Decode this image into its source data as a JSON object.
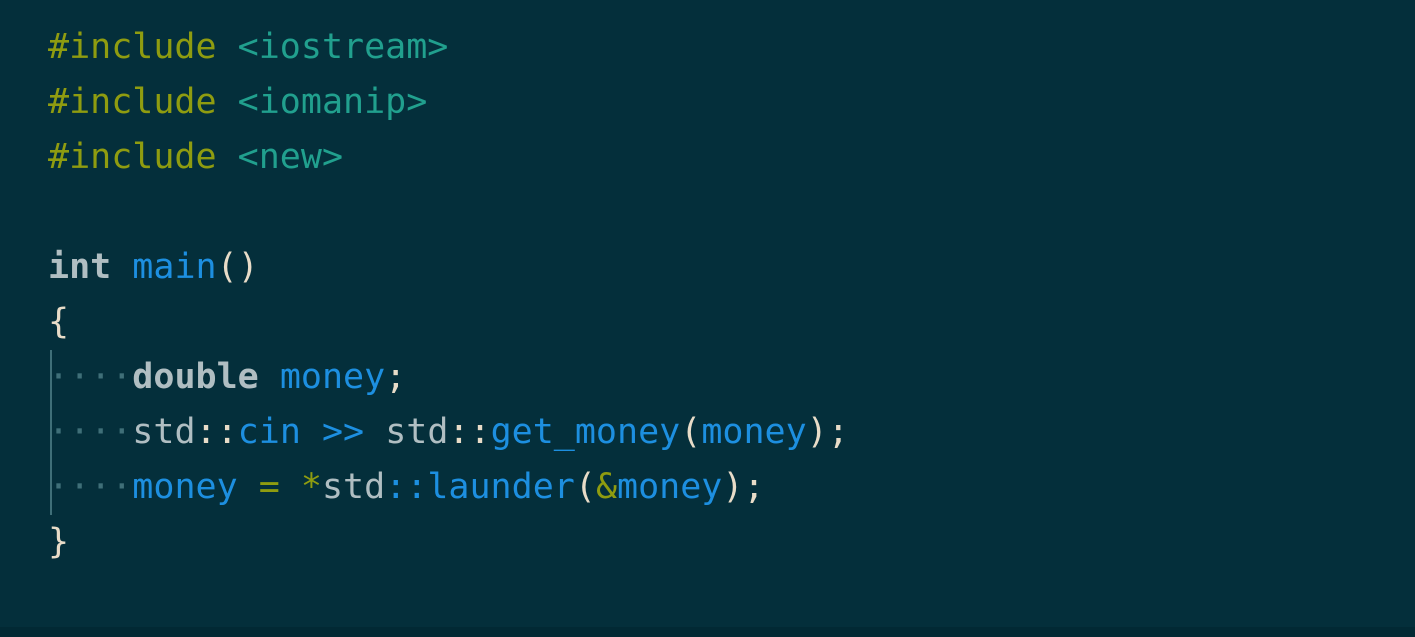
{
  "editor": {
    "language": "cpp",
    "background_color": "#042f3b",
    "whitespace_dot": "·",
    "colors": {
      "background": "#042f3b",
      "preprocessor": "#8f9c10",
      "header_name": "#21a08e",
      "keyword": "#b0bec2",
      "identifier": "#1d8fe0",
      "punctuation": "#e8dcc8",
      "operator": "#8f9c10",
      "namespace": "#b0bec2",
      "indent_guide": "#3f6f78",
      "whitespace_marker": "#3f6f78"
    }
  },
  "code": {
    "lines": [
      {
        "indented": false,
        "tokens": [
          {
            "text": "#include",
            "kind": "preprocessor"
          },
          {
            "text": " ",
            "kind": "plain"
          },
          {
            "text": "<iostream>",
            "kind": "header_name"
          }
        ]
      },
      {
        "indented": false,
        "tokens": [
          {
            "text": "#include",
            "kind": "preprocessor"
          },
          {
            "text": " ",
            "kind": "plain"
          },
          {
            "text": "<iomanip>",
            "kind": "header_name"
          }
        ]
      },
      {
        "indented": false,
        "tokens": [
          {
            "text": "#include",
            "kind": "preprocessor"
          },
          {
            "text": " ",
            "kind": "plain"
          },
          {
            "text": "<new>",
            "kind": "header_name"
          }
        ]
      },
      {
        "indented": false,
        "tokens": []
      },
      {
        "indented": false,
        "tokens": [
          {
            "text": "int",
            "kind": "keyword"
          },
          {
            "text": " ",
            "kind": "plain"
          },
          {
            "text": "main",
            "kind": "identifier"
          },
          {
            "text": "()",
            "kind": "punctuation"
          }
        ]
      },
      {
        "indented": false,
        "tokens": [
          {
            "text": "{",
            "kind": "punctuation"
          }
        ]
      },
      {
        "indented": true,
        "tokens": [
          {
            "text": "····",
            "kind": "whitespace"
          },
          {
            "text": "double",
            "kind": "keyword"
          },
          {
            "text": " ",
            "kind": "plain"
          },
          {
            "text": "money",
            "kind": "identifier"
          },
          {
            "text": ";",
            "kind": "punctuation"
          }
        ]
      },
      {
        "indented": true,
        "tokens": [
          {
            "text": "····",
            "kind": "whitespace"
          },
          {
            "text": "std",
            "kind": "namespace"
          },
          {
            "text": "::",
            "kind": "punctuation"
          },
          {
            "text": "cin",
            "kind": "identifier"
          },
          {
            "text": " ",
            "kind": "plain"
          },
          {
            "text": ">>",
            "kind": "identifier"
          },
          {
            "text": " ",
            "kind": "plain"
          },
          {
            "text": "std",
            "kind": "namespace"
          },
          {
            "text": "::",
            "kind": "punctuation"
          },
          {
            "text": "get_money",
            "kind": "identifier"
          },
          {
            "text": "(",
            "kind": "punctuation"
          },
          {
            "text": "money",
            "kind": "identifier"
          },
          {
            "text": ")",
            "kind": "punctuation"
          },
          {
            "text": ";",
            "kind": "punctuation"
          }
        ]
      },
      {
        "indented": true,
        "tokens": [
          {
            "text": "····",
            "kind": "whitespace"
          },
          {
            "text": "money",
            "kind": "identifier"
          },
          {
            "text": " ",
            "kind": "plain"
          },
          {
            "text": "=",
            "kind": "operator"
          },
          {
            "text": " ",
            "kind": "plain"
          },
          {
            "text": "*",
            "kind": "operator"
          },
          {
            "text": "std",
            "kind": "namespace"
          },
          {
            "text": "::",
            "kind": "colon_blue"
          },
          {
            "text": "launder",
            "kind": "identifier"
          },
          {
            "text": "(",
            "kind": "punctuation"
          },
          {
            "text": "&",
            "kind": "operator"
          },
          {
            "text": "money",
            "kind": "identifier"
          },
          {
            "text": ")",
            "kind": "punctuation"
          },
          {
            "text": ";",
            "kind": "punctuation"
          }
        ]
      },
      {
        "indented": false,
        "tokens": [
          {
            "text": "}",
            "kind": "punctuation"
          }
        ]
      }
    ]
  }
}
